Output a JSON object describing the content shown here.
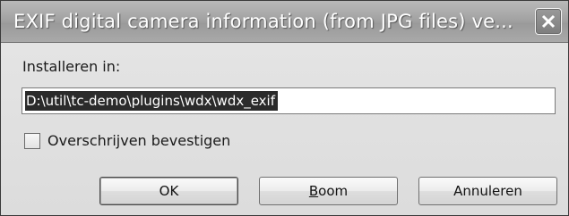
{
  "window": {
    "title": "EXIF digital camera information (from JPG files) ve..."
  },
  "form": {
    "install_label": "Installeren in:",
    "install_path": "D:\\util\\tc-demo\\plugins\\wdx\\wdx_exif",
    "confirm_overwrite_label": "Overschrijven bevestigen",
    "confirm_overwrite_checked": false
  },
  "buttons": {
    "ok_label": "OK",
    "boom_mnemonic": "B",
    "boom_rest": "oom",
    "cancel_label": "Annuleren"
  },
  "icons": {
    "close": "close-icon"
  }
}
